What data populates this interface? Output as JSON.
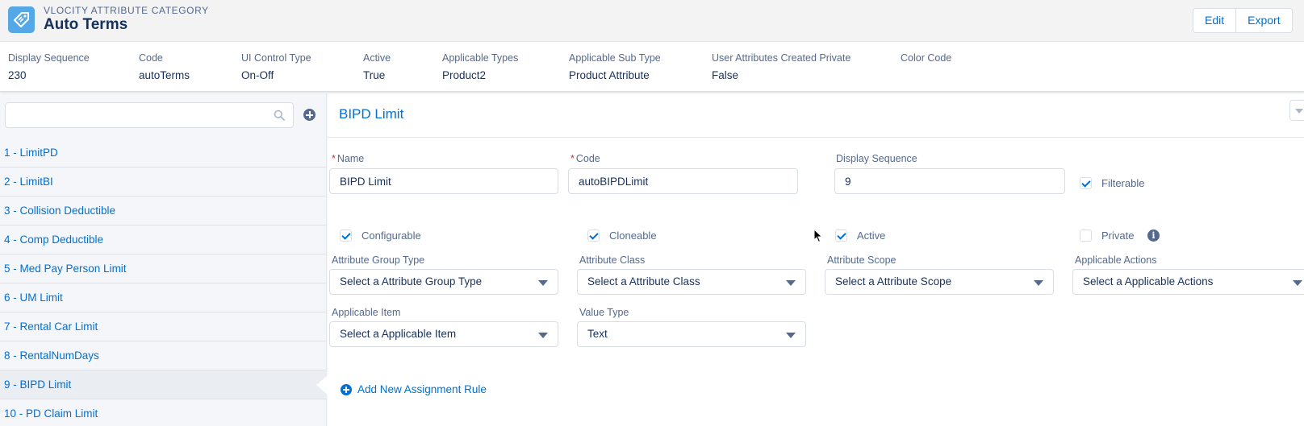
{
  "header": {
    "kicker": "VLOCITY ATTRIBUTE CATEGORY",
    "title": "Auto Terms",
    "icon": "tag-icon",
    "icon_color": "#54a8e6",
    "buttons": {
      "edit": "Edit",
      "export": "Export"
    }
  },
  "highlights": [
    {
      "label": "Display Sequence",
      "value": "230"
    },
    {
      "label": "Code",
      "value": "autoTerms"
    },
    {
      "label": "UI Control Type",
      "value": "On-Off"
    },
    {
      "label": "Active",
      "value": "True"
    },
    {
      "label": "Applicable Types",
      "value": "Product2"
    },
    {
      "label": "Applicable Sub Type",
      "value": "Product Attribute"
    },
    {
      "label": "User Attributes Created Private",
      "value": "False"
    },
    {
      "label": "Color Code",
      "value": ""
    }
  ],
  "sidebar": {
    "search_placeholder": "",
    "items": [
      {
        "label": "1 - LimitPD"
      },
      {
        "label": "2 - LimitBI"
      },
      {
        "label": "3 - Collision Deductible"
      },
      {
        "label": "4 - Comp Deductible"
      },
      {
        "label": "5 - Med Pay Person Limit"
      },
      {
        "label": "6 - UM Limit"
      },
      {
        "label": "7 - Rental Car Limit"
      },
      {
        "label": "8 - RentalNumDays"
      },
      {
        "label": "9 - BIPD Limit"
      },
      {
        "label": "10 - PD Claim Limit"
      }
    ],
    "active_index": 8
  },
  "detail": {
    "title": "BIPD Limit",
    "name": {
      "label": "Name",
      "value": "BIPD Limit"
    },
    "code": {
      "label": "Code",
      "value": "autoBIPDLimit"
    },
    "display_sequence": {
      "label": "Display Sequence",
      "value": "9"
    },
    "checkboxes": {
      "filterable": {
        "label": "Filterable",
        "checked": true
      },
      "configurable": {
        "label": "Configurable",
        "checked": true
      },
      "cloneable": {
        "label": "Cloneable",
        "checked": true
      },
      "active": {
        "label": "Active",
        "checked": true
      },
      "private": {
        "label": "Private",
        "checked": false
      }
    },
    "selects": {
      "attribute_group_type": {
        "label": "Attribute Group Type",
        "value": "Select a Attribute Group Type"
      },
      "attribute_class": {
        "label": "Attribute Class",
        "value": "Select a Attribute Class"
      },
      "attribute_scope": {
        "label": "Attribute Scope",
        "value": "Select a Attribute Scope"
      },
      "applicable_actions": {
        "label": "Applicable Actions",
        "value": "Select a Applicable Actions"
      },
      "applicable_item": {
        "label": "Applicable Item",
        "value": "Select a Applicable Item"
      },
      "value_type": {
        "label": "Value Type",
        "value": "Text"
      }
    },
    "add_rule_label": "Add New Assignment Rule"
  },
  "colors": {
    "link": "#0070d2",
    "text": "#16325c",
    "label": "#54698d",
    "required": "#c23934"
  }
}
